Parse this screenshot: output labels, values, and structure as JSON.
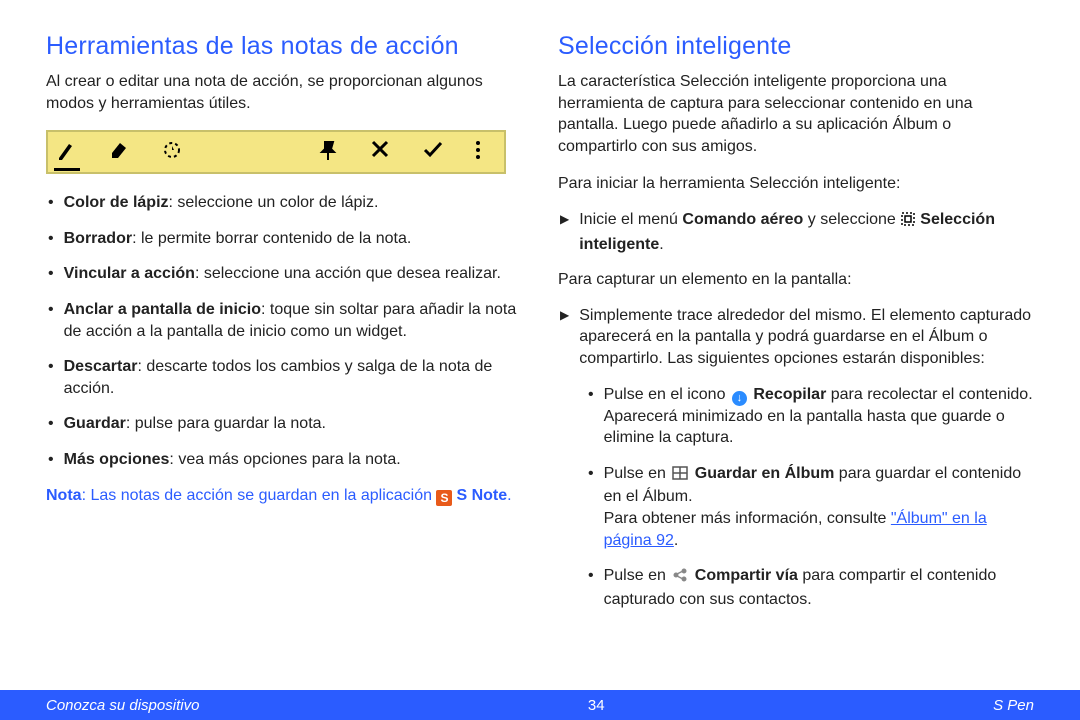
{
  "left": {
    "heading": "Herramientas de las notas de acción",
    "intro": "Al crear o editar una nota de acción, se proporcionan algunos modos y herramientas útiles.",
    "tools": [
      {
        "term": "Color de lápiz",
        "desc": ": seleccione un color de lápiz."
      },
      {
        "term": "Borrador",
        "desc": ": le permite borrar contenido de la nota."
      },
      {
        "term": "Vincular a acción",
        "desc": ": seleccione una acción que desea realizar."
      },
      {
        "term": "Anclar a pantalla de inicio",
        "desc": ": toque sin soltar para añadir la nota de acción a la pantalla de inicio como un widget."
      },
      {
        "term": "Descartar",
        "desc": ": descarte todos los cambios y salga de la nota de acción."
      },
      {
        "term": "Guardar",
        "desc": ": pulse para guardar la nota."
      },
      {
        "term": "Más opciones",
        "desc": ": vea más opciones para la nota."
      }
    ],
    "note_prefix": "Nota",
    "note_body": ": Las notas de acción se guardan en la aplicación ",
    "note_app": "S Note",
    "note_period": ".",
    "toolbar_icons": [
      "pen",
      "eraser",
      "link",
      "pin",
      "cross",
      "check",
      "more"
    ]
  },
  "right": {
    "heading": "Selección inteligente",
    "intro": "La característica Selección inteligente proporciona una herramienta de captura para seleccionar contenido en una pantalla. Luego puede añadirlo a su aplicación Álbum o compartirlo con sus amigos.",
    "start_line": "Para iniciar la herramienta Selección inteligente:",
    "start_step_a": "Inicie el menú ",
    "start_step_b": "Comando aéreo",
    "start_step_c": " y seleccione ",
    "start_step_d": "Selección inteligente",
    "start_step_e": ".",
    "capture_line": "Para capturar un elemento en la pantalla:",
    "capture_step": "Simplemente trace alrededor del mismo. El elemento capturado aparecerá en la pantalla y podrá guardarse en el Álbum o compartirlo. Las siguientes opciones estarán disponibles:",
    "opts": {
      "collect_a": "Pulse en el icono ",
      "collect_term": "Recopilar",
      "collect_b": " para recolectar el contenido. Aparecerá minimizado en la pantalla hasta que guarde o elimine la captura.",
      "save_a": "Pulse en ",
      "save_term": "Guardar en Álbum",
      "save_b": " para guardar el contenido en el Álbum.",
      "save_more": "Para obtener más información, consulte ",
      "save_ref": "\"Álbum\" en la página 92",
      "save_period": ".",
      "share_a": "Pulse en ",
      "share_term": "Compartir vía",
      "share_b": " para compartir el contenido capturado con sus contactos."
    }
  },
  "footer": {
    "left": "Conozca su dispositivo",
    "center": "34",
    "right": "S Pen"
  },
  "icons": {
    "collect_glyph": "↓"
  }
}
